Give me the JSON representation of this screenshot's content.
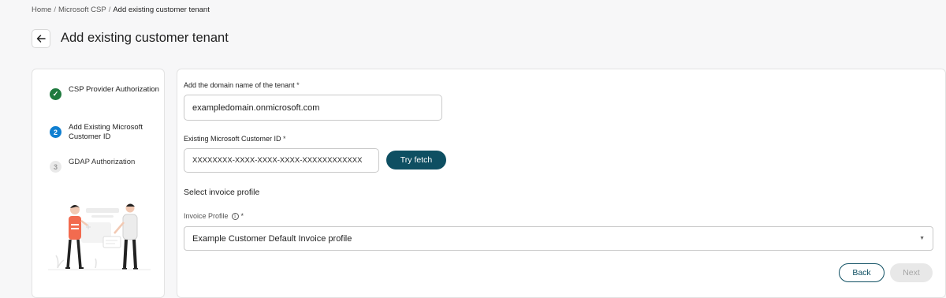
{
  "breadcrumb": [
    "Home",
    "Microsoft CSP",
    "Add existing customer tenant"
  ],
  "breadcrumb_separator": "/",
  "page": {
    "title": "Add existing customer tenant"
  },
  "icons": {
    "back": "arrow-left-icon",
    "done": "check-icon",
    "info": "info-icon",
    "dropdown": "caret-down-icon"
  },
  "steps": [
    {
      "label": "CSP Provider Authorization",
      "state": "done",
      "marker": "✓"
    },
    {
      "label": "Add Existing Microsoft Customer ID",
      "state": "active",
      "marker": "2"
    },
    {
      "label": "GDAP Authorization",
      "state": "pending",
      "marker": "3"
    }
  ],
  "form": {
    "domain": {
      "label": "Add the domain name of the tenant",
      "required": "*",
      "value": "exampledomain.onmicrosoft.com"
    },
    "customer_id": {
      "label": "Existing Microsoft Customer ID",
      "required": "*",
      "value": "XXXXXXXX-XXXX-XXXX-XXXX-XXXXXXXXXXXX"
    },
    "fetch_label": "Try fetch",
    "invoice_section_title": "Select invoice profile",
    "invoice": {
      "label": "Invoice Profile",
      "info": "i",
      "required": "*",
      "selected": "Example Customer Default Invoice profile",
      "caret": "▼"
    }
  },
  "actions": {
    "back_label": "Back",
    "next_label": "Next"
  },
  "colors": {
    "primary": "#0e4f62",
    "done": "#1f7a3e",
    "active": "#0f7fd1",
    "accent": "#f26b4f"
  }
}
